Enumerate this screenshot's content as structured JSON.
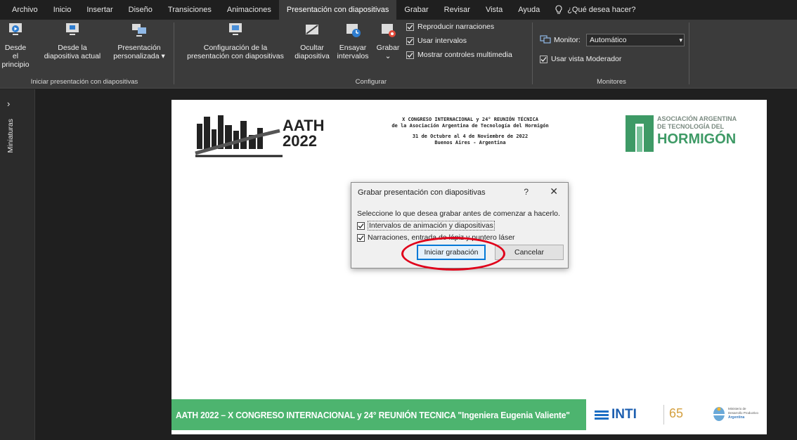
{
  "tabs": [
    {
      "label": "Archivo",
      "active": false
    },
    {
      "label": "Inicio",
      "active": false
    },
    {
      "label": "Insertar",
      "active": false
    },
    {
      "label": "Diseño",
      "active": false
    },
    {
      "label": "Transiciones",
      "active": false
    },
    {
      "label": "Animaciones",
      "active": false
    },
    {
      "label": "Presentación con diapositivas",
      "active": true
    },
    {
      "label": "Grabar",
      "active": false
    },
    {
      "label": "Revisar",
      "active": false
    },
    {
      "label": "Vista",
      "active": false
    },
    {
      "label": "Ayuda",
      "active": false
    }
  ],
  "tell_me": {
    "icon": "lightbulb-icon",
    "label": "¿Qué desea hacer?"
  },
  "ribbon": {
    "start_group": {
      "label": "Iniciar presentación con diapositivas",
      "from_beginning": {
        "line1": "Desde el",
        "line2": "principio"
      },
      "from_current": {
        "line1": "Desde la",
        "line2": "diapositiva actual"
      },
      "custom": {
        "line1": "Presentación",
        "line2": "personalizada",
        "dropdown": "▾"
      }
    },
    "setup_group": {
      "label": "Configurar",
      "setup": {
        "line1": "Configuración de la",
        "line2": "presentación con diapositivas"
      },
      "hide": {
        "line1": "Ocultar",
        "line2": "diapositiva"
      },
      "rehearse": {
        "line1": "Ensayar",
        "line2": "intervalos"
      },
      "record": {
        "line1": "Grabar",
        "line2": "⌄"
      },
      "play_narrations": "Reproducir narraciones",
      "use_timings": "Usar intervalos",
      "show_media_controls": "Mostrar controles multimedia"
    },
    "monitors_group": {
      "label": "Monitores",
      "monitor_label": "Monitor:",
      "monitor_value": "Automático",
      "presenter_view": "Usar vista Moderador"
    }
  },
  "left_pane": {
    "chevron": "›",
    "label": "Miniaturas"
  },
  "slide": {
    "logo_text": {
      "aath": "AATH",
      "year": "2022"
    },
    "header_lines": [
      "X CONGRESO INTERNACIONAL y 24° REUNIÓN TÉCNICA",
      "de la Asociación Argentina de Tecnología del Hormigón",
      "31 de Octubre al 4 de Noviembre de 2022",
      "Buenos Aires - Argentina"
    ],
    "assoc": {
      "line1": "ASOCIACIÓN ARGENTINA",
      "line2": "DE TECNOLOGÍA DEL",
      "line3": "HORMIGÓN"
    },
    "footer": "AATH 2022 – X CONGRESO INTERNACIONAL y 24° REUNIÓN TECNICA \"Ingeniera Eugenia Valiente\"",
    "inti": "INTI",
    "inti_years": "65",
    "ministerio": {
      "line1": "Ministerio de",
      "line2": "Desarrollo Productivo",
      "line3": "Argentina"
    }
  },
  "dialog": {
    "title": "Grabar presentación con diapositivas",
    "help": "?",
    "close": "✕",
    "instruction": "Seleccione lo que desea grabar antes de comenzar a hacerlo.",
    "option1": "Intervalos de animación y diapositivas",
    "option2": "Narraciones, entrada de lápiz y puntero láser",
    "start_button": "Iniciar grabación",
    "cancel_button": "Cancelar"
  },
  "colors": {
    "accent": "#0078d7",
    "highlight": "#e0001a",
    "footer_green": "#4db46f",
    "ribbon": "#3b3b3b",
    "tabs": "#1f1f1f"
  }
}
